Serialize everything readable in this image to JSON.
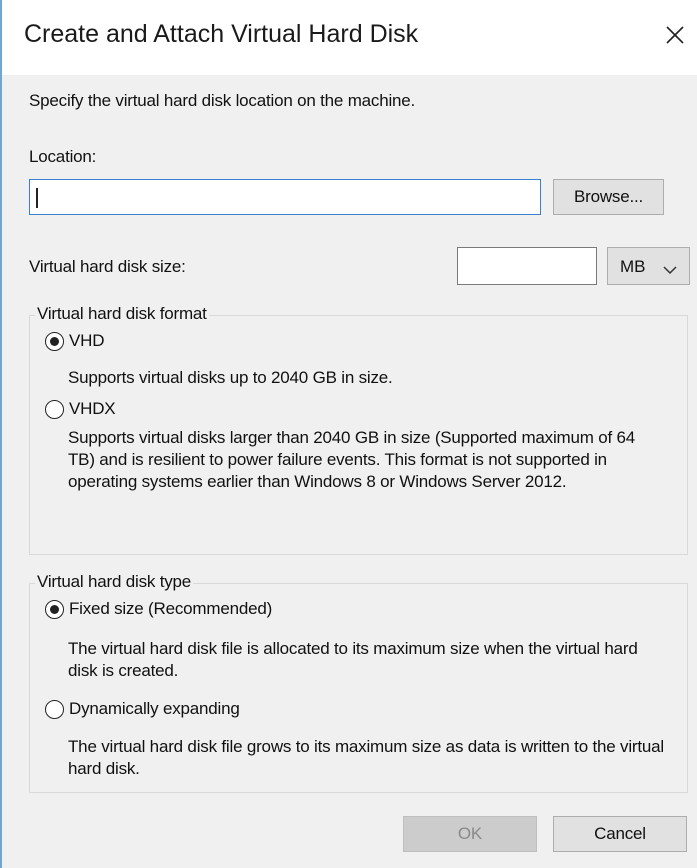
{
  "window": {
    "title": "Create and Attach Virtual Hard Disk"
  },
  "icons": {
    "close": "close-icon",
    "dropdown": "chevron-down-icon"
  },
  "intro": "Specify the virtual hard disk location on the machine.",
  "location": {
    "label": "Location:",
    "value": "",
    "browse_label": "Browse..."
  },
  "size": {
    "label": "Virtual hard disk size:",
    "value": "",
    "unit": "MB"
  },
  "format_group": {
    "legend": "Virtual hard disk format",
    "options": [
      {
        "label": "VHD",
        "selected": true,
        "desc": "Supports virtual disks up to 2040 GB in size."
      },
      {
        "label": "VHDX",
        "selected": false,
        "desc": "Supports virtual disks larger than 2040 GB in size (Supported maximum of 64 TB) and is resilient to power failure events. This format is not supported in operating systems earlier than Windows 8 or Windows Server 2012."
      }
    ]
  },
  "type_group": {
    "legend": "Virtual hard disk type",
    "options": [
      {
        "label": "Fixed size (Recommended)",
        "selected": true,
        "desc": "The virtual hard disk file is allocated to its maximum size when the virtual hard disk is created."
      },
      {
        "label": "Dynamically expanding",
        "selected": false,
        "desc": "The virtual hard disk file grows to its maximum size as data is written to the virtual hard disk."
      }
    ]
  },
  "buttons": {
    "ok": "OK",
    "cancel": "Cancel"
  },
  "colors": {
    "accent": "#3a7fd0",
    "window_border": "#6aa8dc",
    "client_bg": "#f0f0f0"
  }
}
